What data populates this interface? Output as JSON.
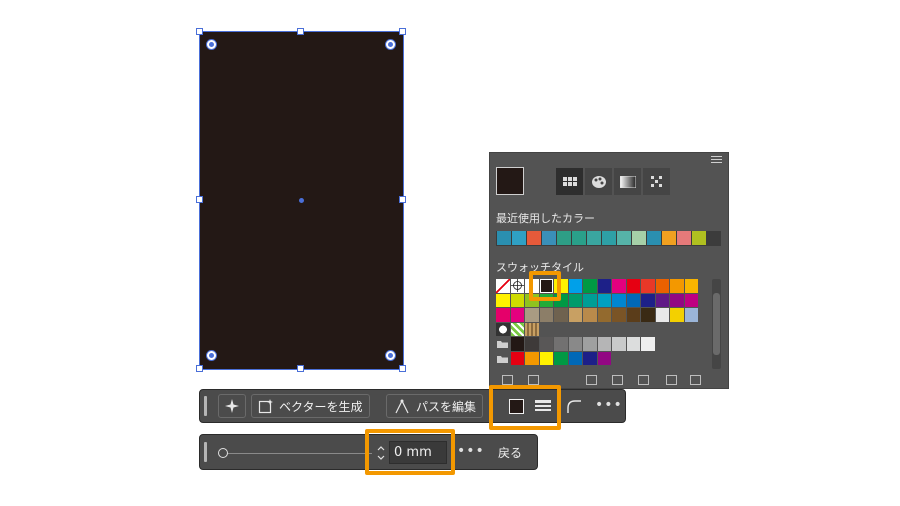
{
  "canvas": {
    "shape_fill": "#231815",
    "selection_color": "#4a6fd8"
  },
  "swatches_panel": {
    "menu_icon": "panel-menu-icon",
    "current_fill": "#231815",
    "view_icons": [
      "grid-view-icon",
      "color-group-icon",
      "gradient-icon",
      "pattern-icon"
    ],
    "recent_label": "最近使用したカラー",
    "recent_colors": [
      "#2a8fb0",
      "#2fa0c4",
      "#e65a3a",
      "#3a8fb8",
      "#2e9e86",
      "#2aa08a",
      "#3aa6a0",
      "#2ea0a6",
      "#56b3a8",
      "#a6d0a8",
      "#2a8fb0",
      "#f0a020",
      "#e67a7a",
      "#b0c020"
    ],
    "tile_label": "スウォッチタイル",
    "tile_rows": [
      [
        "none",
        "registration",
        "#ffffff",
        "#231815",
        "#fff100",
        "#00a0e9",
        "#009944",
        "#1d2088",
        "#e4007f",
        "#e60012",
        "#e83828",
        "#eb6100",
        "#f39800",
        "#f8b500"
      ],
      [
        "#fff100",
        "#cfdb00",
        "#8fc31f",
        "#22ac38",
        "#009944",
        "#009b6b",
        "#009e96",
        "#00a0c1",
        "#0086d1",
        "#0068b7",
        "#1d2088",
        "#601986",
        "#920783",
        "#be0081"
      ],
      [
        "#e5006a",
        "#e4007f",
        "#a99b82",
        "#8c7e68",
        "#6f624f",
        "#c8a063",
        "#b98a4b",
        "#936a2e",
        "#7a5426",
        "#5b3d1a",
        "#3a2a14",
        "#e9e9e9",
        "#f3d000",
        "#9bb5d8"
      ],
      [
        "pattern-a",
        "pattern-b",
        "pattern-c"
      ],
      [
        "folder",
        "#231815",
        "#3e3a39",
        "#595757",
        "#727171",
        "#898989",
        "#9fa0a0",
        "#b5b5b6",
        "#c9caca",
        "#dcdddd",
        "#efefef"
      ],
      [
        "folder",
        "#e60012",
        "#f39800",
        "#fff100",
        "#009944",
        "#0068b7",
        "#1d2088",
        "#920783"
      ]
    ],
    "footer_icons": [
      "swatch-libraries-icon",
      "show-kinds-icon",
      "swatch-options-icon",
      "new-color-group-icon",
      "new-swatch-icon",
      "delete-swatch-icon"
    ]
  },
  "taskbar": {
    "generate_vector_label": "ベクターを生成",
    "edit_path_label": "パスを編集",
    "more_label": "•••"
  },
  "corner_bar": {
    "value": "0 mm",
    "more_label": "•••",
    "back_label": "戻る"
  },
  "highlight_color": "#f39800"
}
